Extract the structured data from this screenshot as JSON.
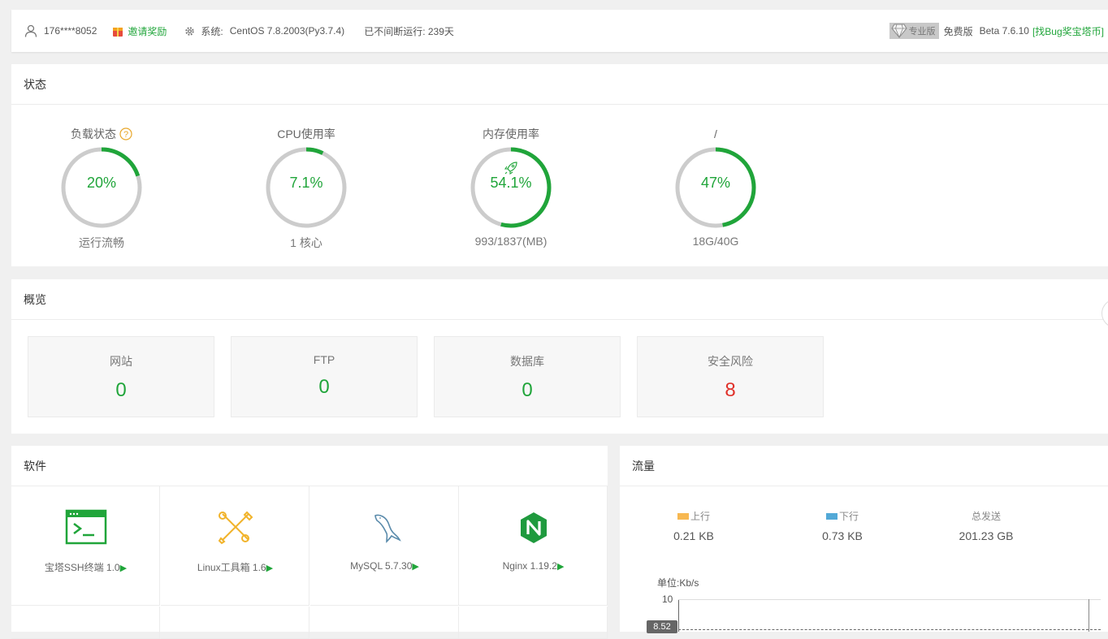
{
  "topbar": {
    "user": "176****8052",
    "invite": "邀请奖励",
    "system_label": "系统:",
    "system_value": "CentOS 7.8.2003(Py3.7.4)",
    "uptime": "已不间断运行: 239天",
    "pro_badge": "专业版",
    "free_edition": "免费版",
    "version": "Beta 7.6.10",
    "bug_link": "[找Bug奖宝塔币]"
  },
  "status": {
    "title": "状态",
    "gauges": [
      {
        "label": "负载状态",
        "value": "20%",
        "sub": "运行流畅",
        "fraction": 0.2
      },
      {
        "label": "CPU使用率",
        "value": "7.1%",
        "sub": "1 核心",
        "fraction": 0.071
      },
      {
        "label": "内存使用率",
        "value": "54.1%",
        "sub": "993/1837(MB)",
        "fraction": 0.541
      },
      {
        "label": "/",
        "value": "47%",
        "sub": "18G/40G",
        "fraction": 0.47
      }
    ]
  },
  "overview": {
    "title": "概览",
    "items": [
      {
        "label": "网站",
        "value": "0"
      },
      {
        "label": "FTP",
        "value": "0"
      },
      {
        "label": "数据库",
        "value": "0"
      },
      {
        "label": "安全风险",
        "value": "8"
      }
    ]
  },
  "software": {
    "title": "软件",
    "items": [
      {
        "label": "宝塔SSH终端 1.0",
        "play": "▶"
      },
      {
        "label": "Linux工具箱 1.6",
        "play": "▶"
      },
      {
        "label": "MySQL 5.7.30",
        "play": "▶"
      },
      {
        "label": "Nginx 1.19.2",
        "play": "▶"
      }
    ]
  },
  "traffic": {
    "title": "流量",
    "up_label": "上行",
    "up_value": "0.21 KB",
    "down_label": "下行",
    "down_value": "0.73 KB",
    "total_label": "总发送",
    "total_value": "201.23 GB",
    "unit": "单位:Kb/s",
    "y_max": "10",
    "tooltip": "8.52"
  },
  "colors": {
    "accent": "#20a53a",
    "danger": "#e0312a",
    "up": "#f7b851",
    "down": "#52a9d7"
  }
}
